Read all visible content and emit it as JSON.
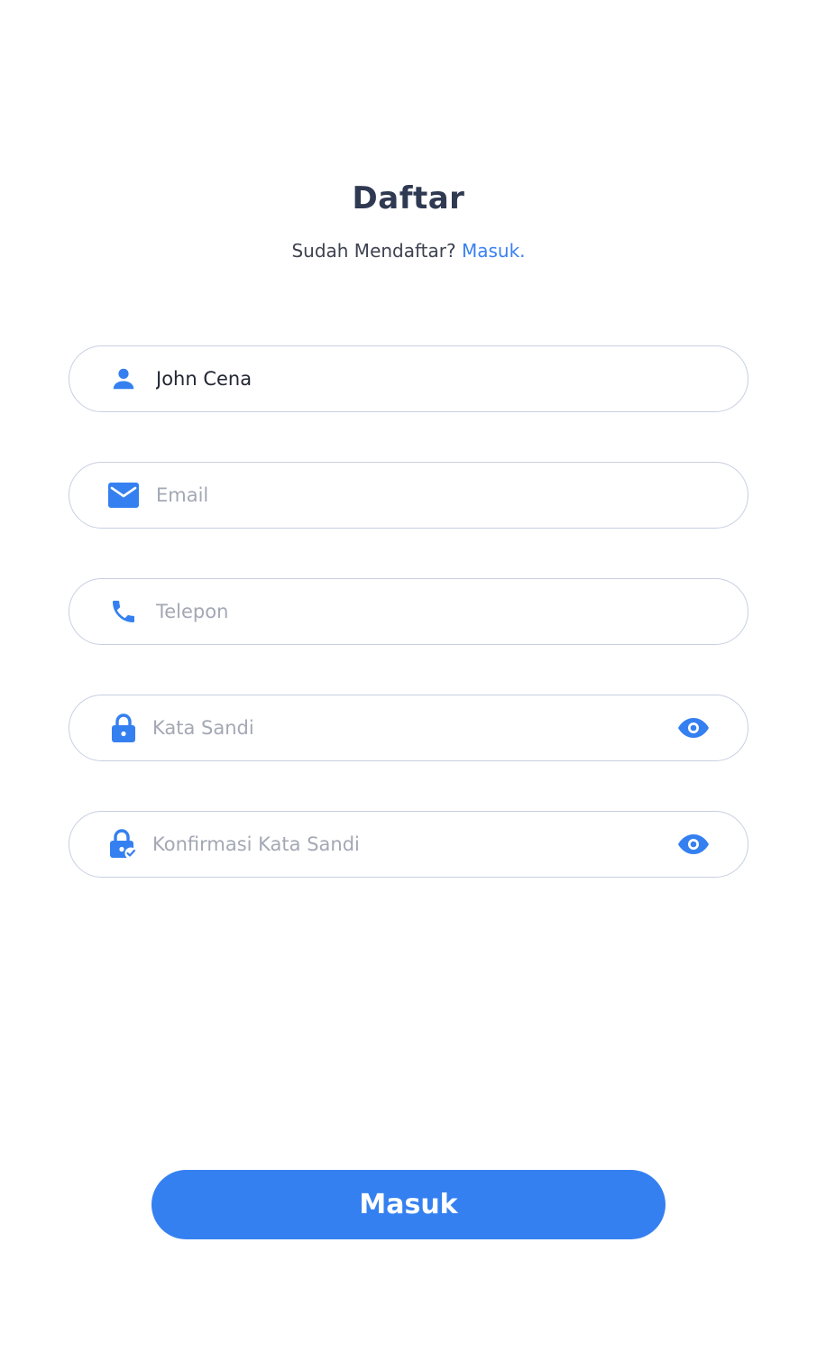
{
  "header": {
    "title": "Daftar",
    "subtitle_text": "Sudah Mendaftar?",
    "login_link": "Masuk."
  },
  "form": {
    "name": {
      "value": "John Cena",
      "icon": "person-icon"
    },
    "email": {
      "placeholder": "Email",
      "value": "",
      "icon": "mail-icon"
    },
    "phone": {
      "placeholder": "Telepon",
      "value": "",
      "icon": "phone-icon"
    },
    "password": {
      "placeholder": "Kata Sandi",
      "value": "",
      "icon": "lock-icon",
      "toggle_icon": "eye-icon"
    },
    "confirm_password": {
      "placeholder": "Konfirmasi Kata Sandi",
      "value": "",
      "icon": "lock-check-icon",
      "toggle_icon": "eye-icon"
    }
  },
  "submit_label": "Masuk",
  "colors": {
    "accent": "#3580f0",
    "link": "#3a80f0",
    "title": "#2f3a52",
    "border": "#c7cfe0",
    "placeholder": "#a3a8b4"
  }
}
